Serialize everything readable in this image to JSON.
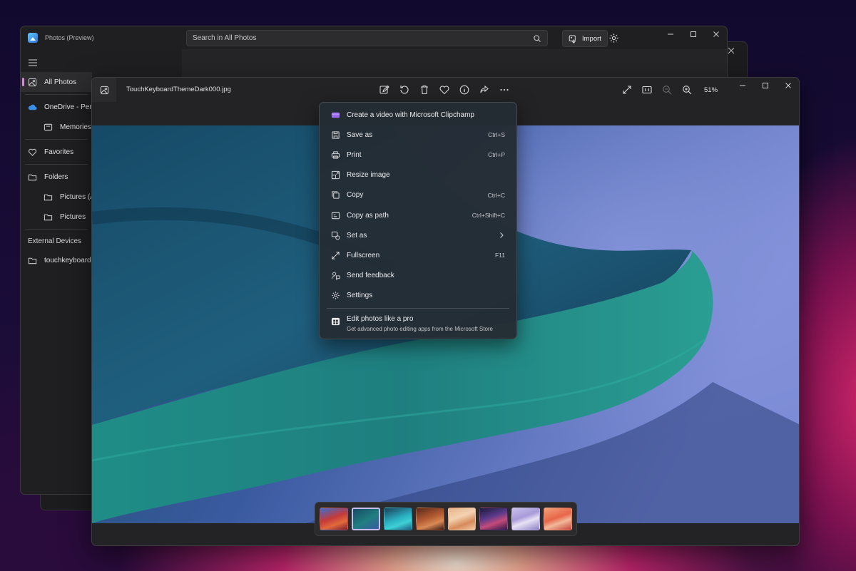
{
  "back_window": {
    "title": "Photos (Preview)",
    "search_placeholder": "Search in All Photos",
    "import_label": "Import",
    "sidebar": {
      "all_photos": "All Photos",
      "onedrive": "OneDrive - Pers",
      "memories": "Memories",
      "favorites": "Favorites",
      "folders": "Folders",
      "pictures_a": "Pictures (A",
      "pictures": "Pictures",
      "external_devices": "External Devices",
      "touchkeyboard": "touchkeyboard"
    }
  },
  "viewer": {
    "filename": "TouchKeyboardThemeDark000.jpg",
    "zoom": "51%",
    "tools": [
      "edit-icon",
      "rotate-icon",
      "delete-icon",
      "favorite-icon",
      "info-icon",
      "share-icon",
      "more-icon"
    ]
  },
  "context_menu": {
    "items": [
      {
        "label": "Create a video with Microsoft Clipchamp",
        "shortcut": "",
        "icon": "clipchamp-icon"
      },
      {
        "label": "Save as",
        "shortcut": "Ctrl+S",
        "icon": "save-icon"
      },
      {
        "label": "Print",
        "shortcut": "Ctrl+P",
        "icon": "print-icon"
      },
      {
        "label": "Resize image",
        "shortcut": "",
        "icon": "resize-icon"
      },
      {
        "label": "Copy",
        "shortcut": "Ctrl+C",
        "icon": "copy-icon"
      },
      {
        "label": "Copy as path",
        "shortcut": "Ctrl+Shift+C",
        "icon": "copy-path-icon"
      },
      {
        "label": "Set as",
        "shortcut": "",
        "icon": "set-as-icon"
      },
      {
        "label": "Fullscreen",
        "shortcut": "F11",
        "icon": "fullscreen-icon"
      },
      {
        "label": "Send feedback",
        "shortcut": "",
        "icon": "feedback-icon"
      },
      {
        "label": "Settings",
        "shortcut": "",
        "icon": "settings-icon"
      }
    ],
    "promo": {
      "title": "Edit photos like a pro",
      "subtitle": "Get advanced photo editing apps from the Microsoft Store",
      "icon": "store-icon"
    }
  },
  "colors": {
    "accent": "#d78ad8",
    "menu_bg": "#242c34",
    "window_bg": "#1f1f21"
  }
}
